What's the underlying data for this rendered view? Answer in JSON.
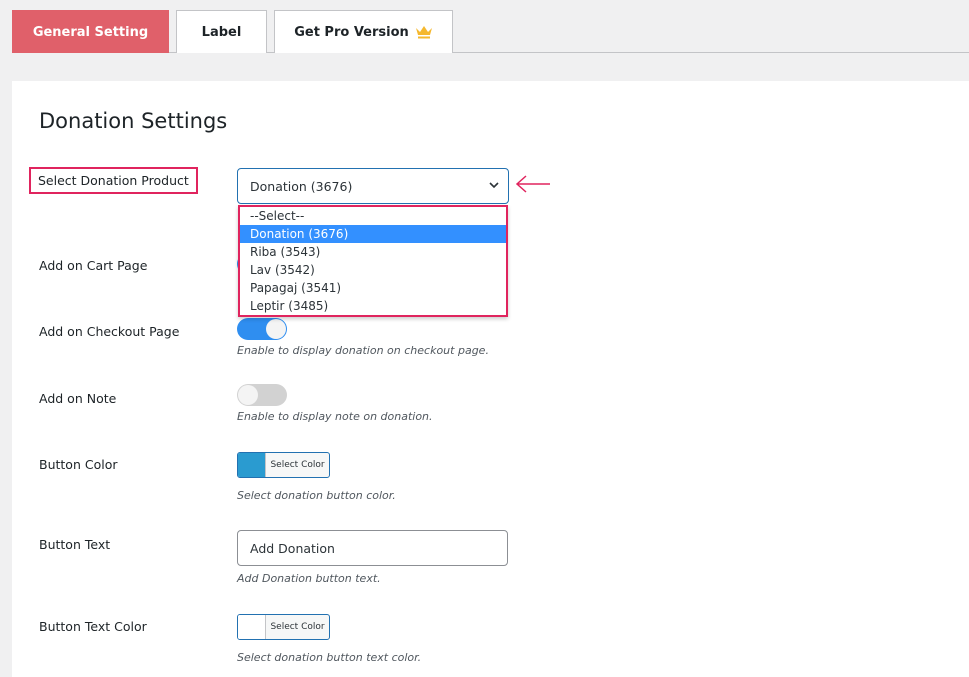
{
  "tabs": [
    {
      "label": "General Setting",
      "active": true
    },
    {
      "label": "Label",
      "active": false
    },
    {
      "label": "Get Pro Version",
      "active": false,
      "icon": "crown-icon"
    }
  ],
  "colors": {
    "accent": "#e0606a",
    "highlight": "#e0245e",
    "toggle_on": "#2f8ef0",
    "button_color": "#2a9bd0",
    "button_text_color": "#ffffff"
  },
  "page": {
    "title": "Donation Settings"
  },
  "fields": {
    "product": {
      "label": "Select Donation Product",
      "value": "Donation (3676)",
      "options": [
        "--Select--",
        "Donation (3676)",
        "Riba (3543)",
        "Lav (3542)",
        "Papagaj (3541)",
        "Leptir (3485)"
      ],
      "selected_index": 1
    },
    "cart": {
      "label": "Add on Cart Page",
      "enabled": true
    },
    "checkout": {
      "label": "Add on Checkout Page",
      "enabled": true,
      "desc": "Enable to display donation on checkout page."
    },
    "note": {
      "label": "Add on Note",
      "enabled": false,
      "desc": "Enable to display note on donation."
    },
    "button_color": {
      "label": "Button Color",
      "button": "Select Color",
      "desc": "Select donation button color."
    },
    "button_text": {
      "label": "Button Text",
      "value": "Add Donation",
      "desc": "Add Donation button text."
    },
    "button_text_color": {
      "label": "Button Text Color",
      "button": "Select Color",
      "desc": "Select donation button text color."
    }
  }
}
